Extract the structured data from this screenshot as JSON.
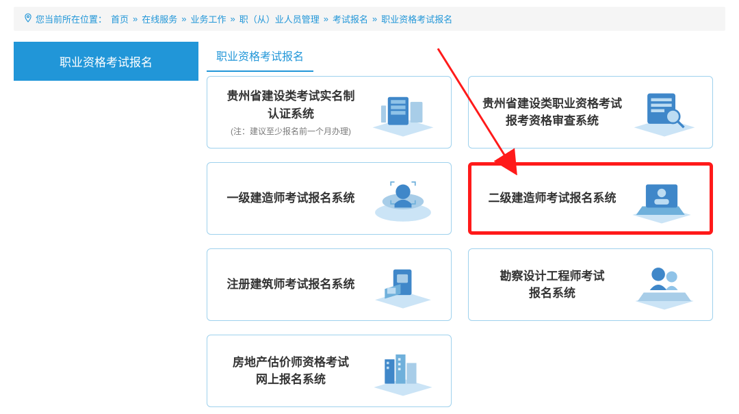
{
  "breadcrumb": {
    "prefix": "您当前所在位置：",
    "items": [
      "首页",
      "在线服务",
      "业务工作",
      "职（从）业人员管理",
      "考试报名",
      "职业资格考试报名"
    ]
  },
  "sidebar": {
    "item_label": "职业资格考试报名"
  },
  "section": {
    "tab_label": "职业资格考试报名"
  },
  "cards": [
    {
      "title_line1": "贵州省建设类考试实名制",
      "title_line2": "认证系统",
      "subtitle": "(注：建议至少报名前一个月办理)",
      "icon": "server",
      "highlight": false
    },
    {
      "title_line1": "贵州省建设类职业资格考试",
      "title_line2": "报考资格审查系统",
      "subtitle": "",
      "icon": "audit",
      "highlight": false
    },
    {
      "title_line1": "一级建造师考试报名系统",
      "title_line2": "",
      "subtitle": "",
      "icon": "person-scan",
      "highlight": false
    },
    {
      "title_line1": "二级建造师考试报名系统",
      "title_line2": "",
      "subtitle": "",
      "icon": "laptop-profile",
      "highlight": true
    },
    {
      "title_line1": "注册建筑师考试报名系统",
      "title_line2": "",
      "subtitle": "",
      "icon": "card-insert",
      "highlight": false
    },
    {
      "title_line1": "勘察设计工程师考试",
      "title_line2": "报名系统",
      "subtitle": "",
      "icon": "person-card",
      "highlight": false
    },
    {
      "title_line1": "房地产估价师资格考试",
      "title_line2": "网上报名系统",
      "subtitle": "",
      "icon": "buildings",
      "highlight": false
    }
  ]
}
